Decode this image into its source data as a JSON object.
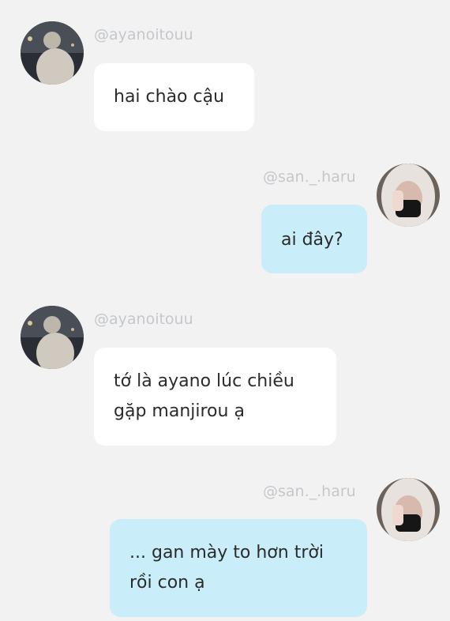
{
  "messages": [
    {
      "sender": "@ayanoitouu",
      "side": "left",
      "lines": [
        "hai chào cậu"
      ]
    },
    {
      "sender": "@san._.haru",
      "side": "right",
      "lines": [
        "ai đây?"
      ]
    },
    {
      "sender": "@ayanoitouu",
      "side": "left",
      "lines": [
        "tớ là ayano lúc chiều",
        "gặp manjirou ạ"
      ]
    },
    {
      "sender": "@san._.haru",
      "side": "right",
      "lines": [
        "... gan mày to hơn trời",
        "rồi con ạ"
      ]
    }
  ],
  "colors": {
    "background": "#f2f2f2",
    "left_bubble": "#ffffff",
    "right_bubble": "#c9eef9",
    "username": "#c4c8cc"
  }
}
